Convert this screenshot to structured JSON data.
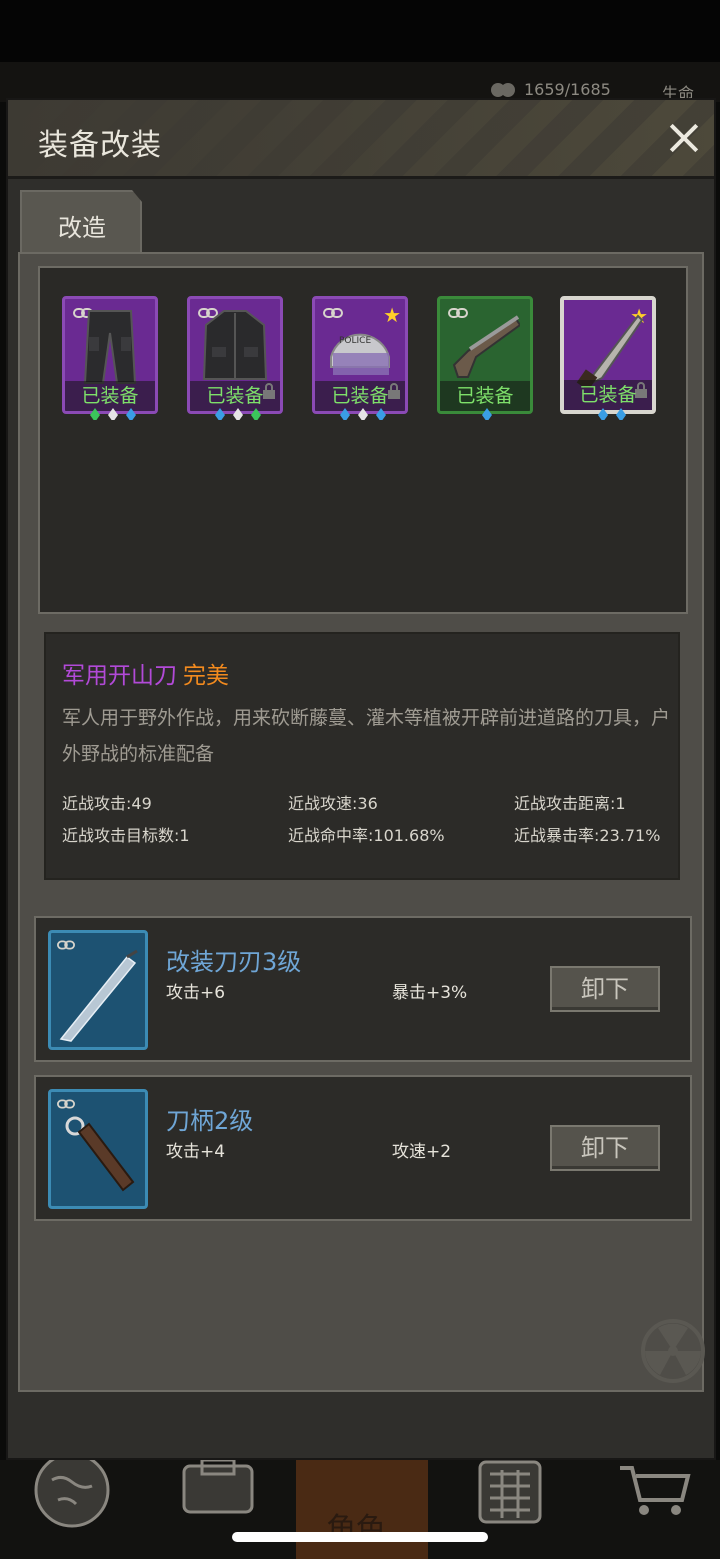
{
  "status": {
    "resource_value": "1659/1685",
    "life_label": "生命"
  },
  "dialog": {
    "title": "装备改装"
  },
  "tabs": [
    {
      "label": "改造"
    }
  ],
  "equipment": [
    {
      "name": "trousers",
      "status": "已装备",
      "rarity": "purple",
      "locked": false,
      "star": false
    },
    {
      "name": "jacket",
      "status": "已装备",
      "rarity": "purple",
      "locked": true,
      "star": false
    },
    {
      "name": "police-helmet",
      "status": "已装备",
      "rarity": "purple",
      "locked": true,
      "star": true,
      "helmet_text": "POLICE"
    },
    {
      "name": "shotgun",
      "status": "已装备",
      "rarity": "green",
      "locked": false,
      "star": false
    },
    {
      "name": "machete",
      "status": "已装备",
      "rarity": "purple",
      "locked": true,
      "star": true,
      "selected": true
    }
  ],
  "item": {
    "name": "军用开山刀",
    "quality": "完美",
    "description": "军人用于野外作战，用来砍断藤蔓、灌木等植被开辟前进道路的刀具，户外野战的标准配备",
    "stats": [
      "近战攻击:49",
      "近战攻速:36",
      "近战攻击距离:1",
      "近战攻击目标数:1",
      "近战命中率:101.68%",
      "近战暴击率:23.71%"
    ]
  },
  "mods": [
    {
      "name": "改装刀刃3级",
      "stat1": "攻击+6",
      "stat2": "暴击+3%",
      "button": "卸下"
    },
    {
      "name": "刀柄2级",
      "stat1": "攻击+4",
      "stat2": "攻速+2",
      "button": "卸下"
    }
  ],
  "nav": {
    "role_label": "角色"
  },
  "colors": {
    "purple_item": "#b24ad8",
    "quality_orange": "#f28a1e",
    "equipped_green": "#7ee06a",
    "mod_blue": "#6fa6d6"
  }
}
